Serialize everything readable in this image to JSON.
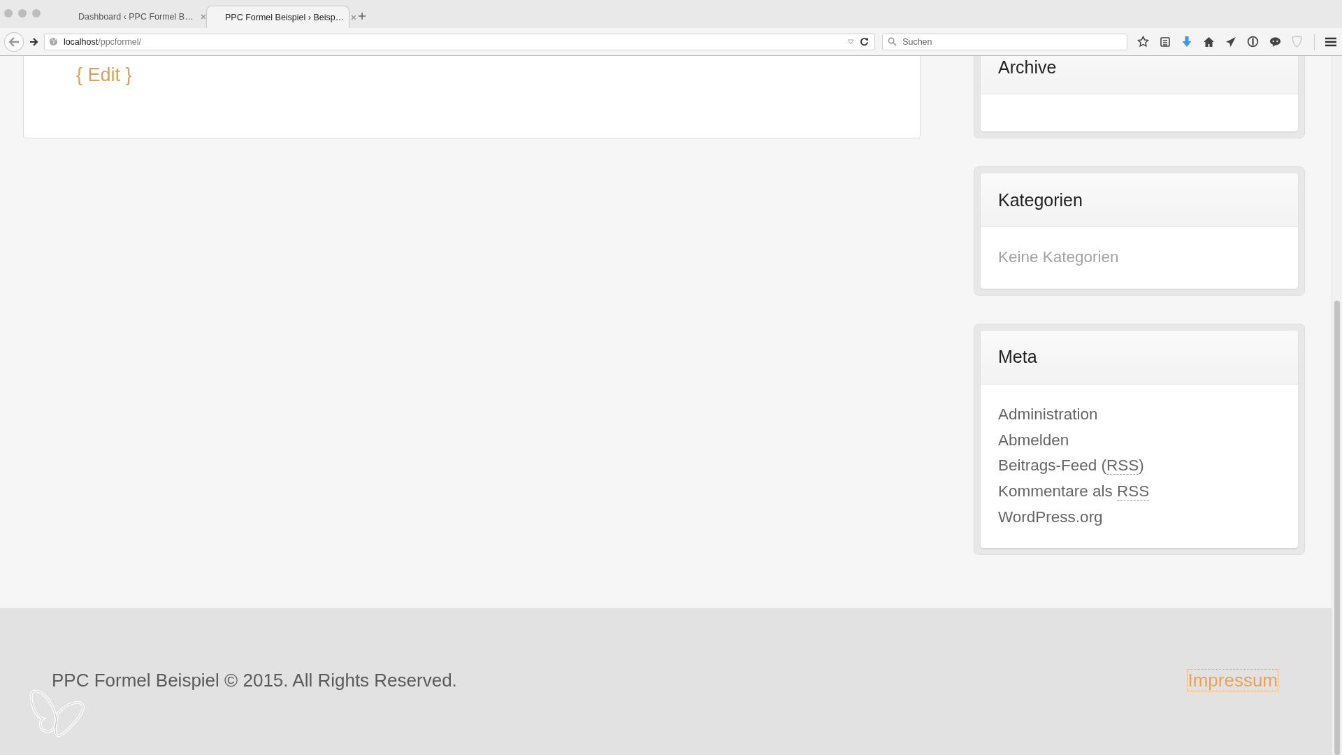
{
  "browser": {
    "tabs": [
      {
        "title": "Dashboard ‹ PPC Formel B…",
        "selected": false
      },
      {
        "title": "PPC Formel Beispiel › Beisp…",
        "selected": true
      }
    ],
    "address": {
      "host": "localhost",
      "path": "/ppcformel/"
    },
    "search": {
      "placeholder": "Suchen"
    }
  },
  "post": {
    "edit_link": "{ Edit }"
  },
  "sidebar": {
    "widgets": [
      {
        "title": "Archive"
      },
      {
        "title": "Kategorien",
        "items": [
          {
            "kind": "empty",
            "parts": [
              {
                "text": "Keine Kategorien"
              }
            ]
          }
        ]
      },
      {
        "title": "Meta",
        "items": [
          {
            "kind": "link",
            "parts": [
              {
                "text": "Administration"
              }
            ]
          },
          {
            "kind": "link",
            "parts": [
              {
                "text": "Abmelden"
              }
            ]
          },
          {
            "kind": "link",
            "parts": [
              {
                "text": "Beitrags-Feed ("
              },
              {
                "text": "RSS",
                "abbr": true
              },
              {
                "text": ")"
              }
            ]
          },
          {
            "kind": "link",
            "parts": [
              {
                "text": "Kommentare als "
              },
              {
                "text": "RSS",
                "abbr": true
              }
            ]
          },
          {
            "kind": "link",
            "parts": [
              {
                "text": "WordPress.org"
              }
            ]
          }
        ]
      }
    ]
  },
  "footer": {
    "copyright": "PPC Formel Beispiel © 2015. All Rights Reserved.",
    "link": {
      "label": "Impressum",
      "focused": true
    }
  }
}
